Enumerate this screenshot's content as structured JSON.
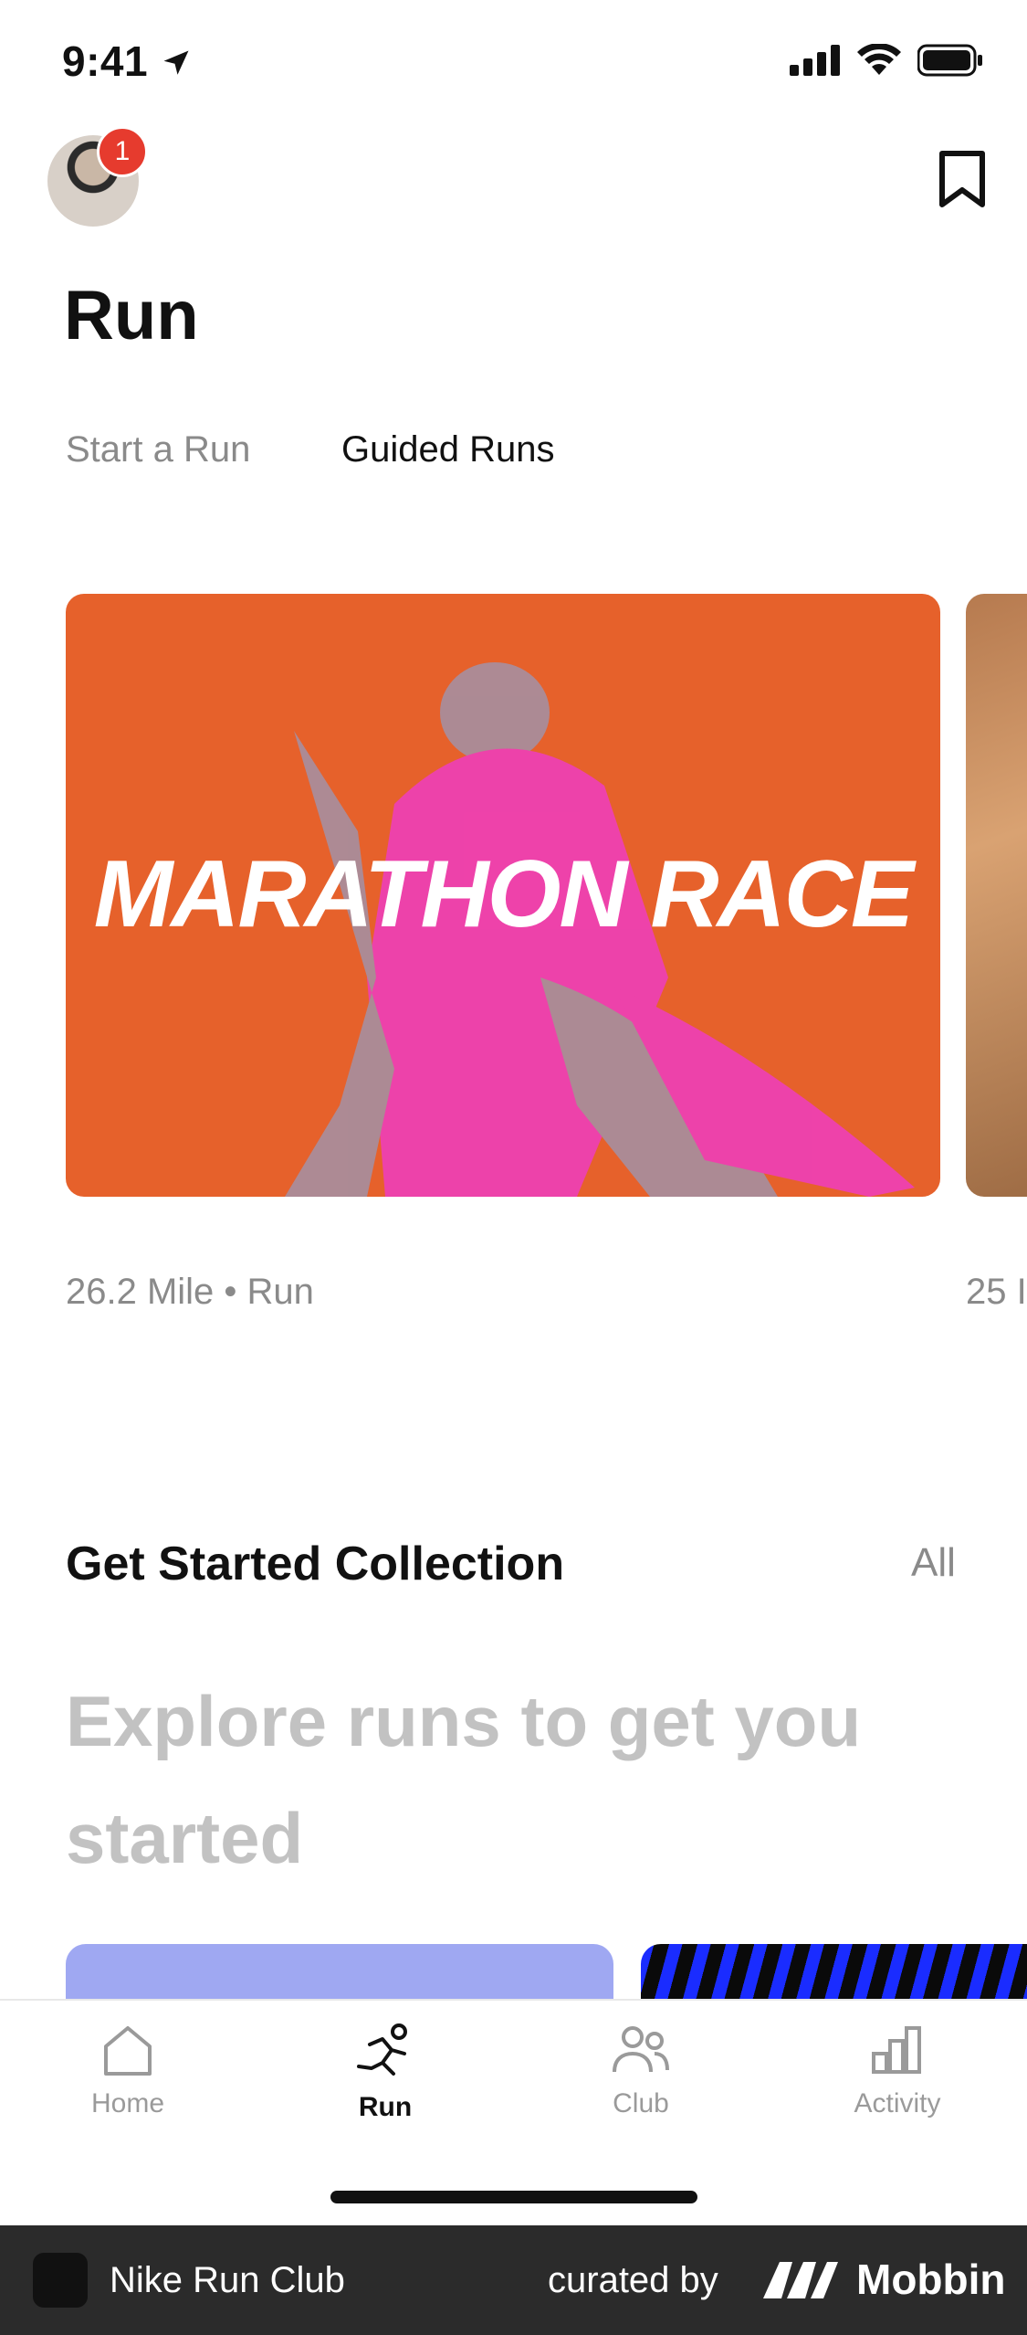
{
  "status_bar": {
    "time": "9:41"
  },
  "header": {
    "notification_count": "1",
    "title": "Run"
  },
  "tabs": [
    {
      "label": "Start a Run",
      "active": false
    },
    {
      "label": "Guided Runs",
      "active": true
    }
  ],
  "guided_runs": [
    {
      "title": "MARATHON RACE",
      "subtitle": "26.2 Mile • Run"
    },
    {
      "title": "",
      "subtitle": "25 I"
    }
  ],
  "collection": {
    "title": "Get Started Collection",
    "all_label": "All",
    "description": "Explore runs to get you started"
  },
  "tab_bar": {
    "items": [
      {
        "label": "Home",
        "icon": "home-icon"
      },
      {
        "label": "Run",
        "icon": "run-icon"
      },
      {
        "label": "Club",
        "icon": "club-icon"
      },
      {
        "label": "Activity",
        "icon": "activity-icon"
      }
    ]
  },
  "footer": {
    "app_name": "Nike Run Club",
    "curated_label": "curated by",
    "brand": "Mobbin"
  },
  "colors": {
    "card_orange": "#e6612b",
    "badge_red": "#e63b2e",
    "tile_lavender": "#9fa8f2"
  }
}
